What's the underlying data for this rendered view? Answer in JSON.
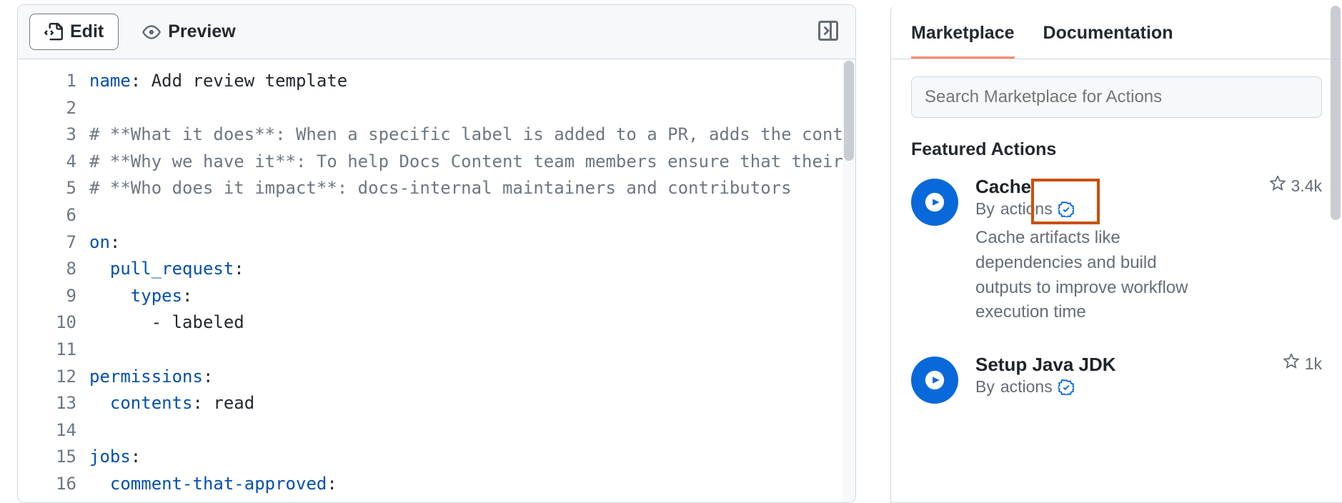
{
  "editor": {
    "tabs": {
      "edit": "Edit",
      "preview": "Preview"
    },
    "gutter": [
      "1",
      "2",
      "3",
      "4",
      "5",
      "6",
      "7",
      "8",
      "9",
      "10",
      "11",
      "12",
      "13",
      "14",
      "15",
      "16"
    ],
    "lines": {
      "l1_key": "name",
      "l1_val": ": Add review template",
      "l3": "# **What it does**: When a specific label is added to a PR, adds the contents ",
      "l4": "# **Why we have it**: To help Docs Content team members ensure that their PR i",
      "l5": "# **Who does it impact**: docs-internal maintainers and contributors",
      "l7_key": "on",
      "l7_val": ":",
      "l8_key": "pull_request",
      "l8_val": ":",
      "l9_key": "types",
      "l9_val": ":",
      "l10": "      - labeled",
      "l12_key": "permissions",
      "l12_val": ":",
      "l13_key": "contents",
      "l13_val": ": read",
      "l15_key": "jobs",
      "l15_val": ":",
      "l16_key": "comment-that-approved",
      "l16_val": ":"
    }
  },
  "sidebar": {
    "tabs": {
      "marketplace": "Marketplace",
      "documentation": "Documentation"
    },
    "search_placeholder": "Search Marketplace for Actions",
    "section_title": "Featured Actions",
    "actions": [
      {
        "title": "Cache",
        "by_prefix": "By ",
        "by": "actions",
        "stars": "3.4k",
        "desc": "Cache artifacts like dependencies and build outputs to improve workflow execution time"
      },
      {
        "title": "Setup Java JDK",
        "by_prefix": "By ",
        "by": "actions",
        "stars": "1k",
        "desc": ""
      }
    ]
  }
}
